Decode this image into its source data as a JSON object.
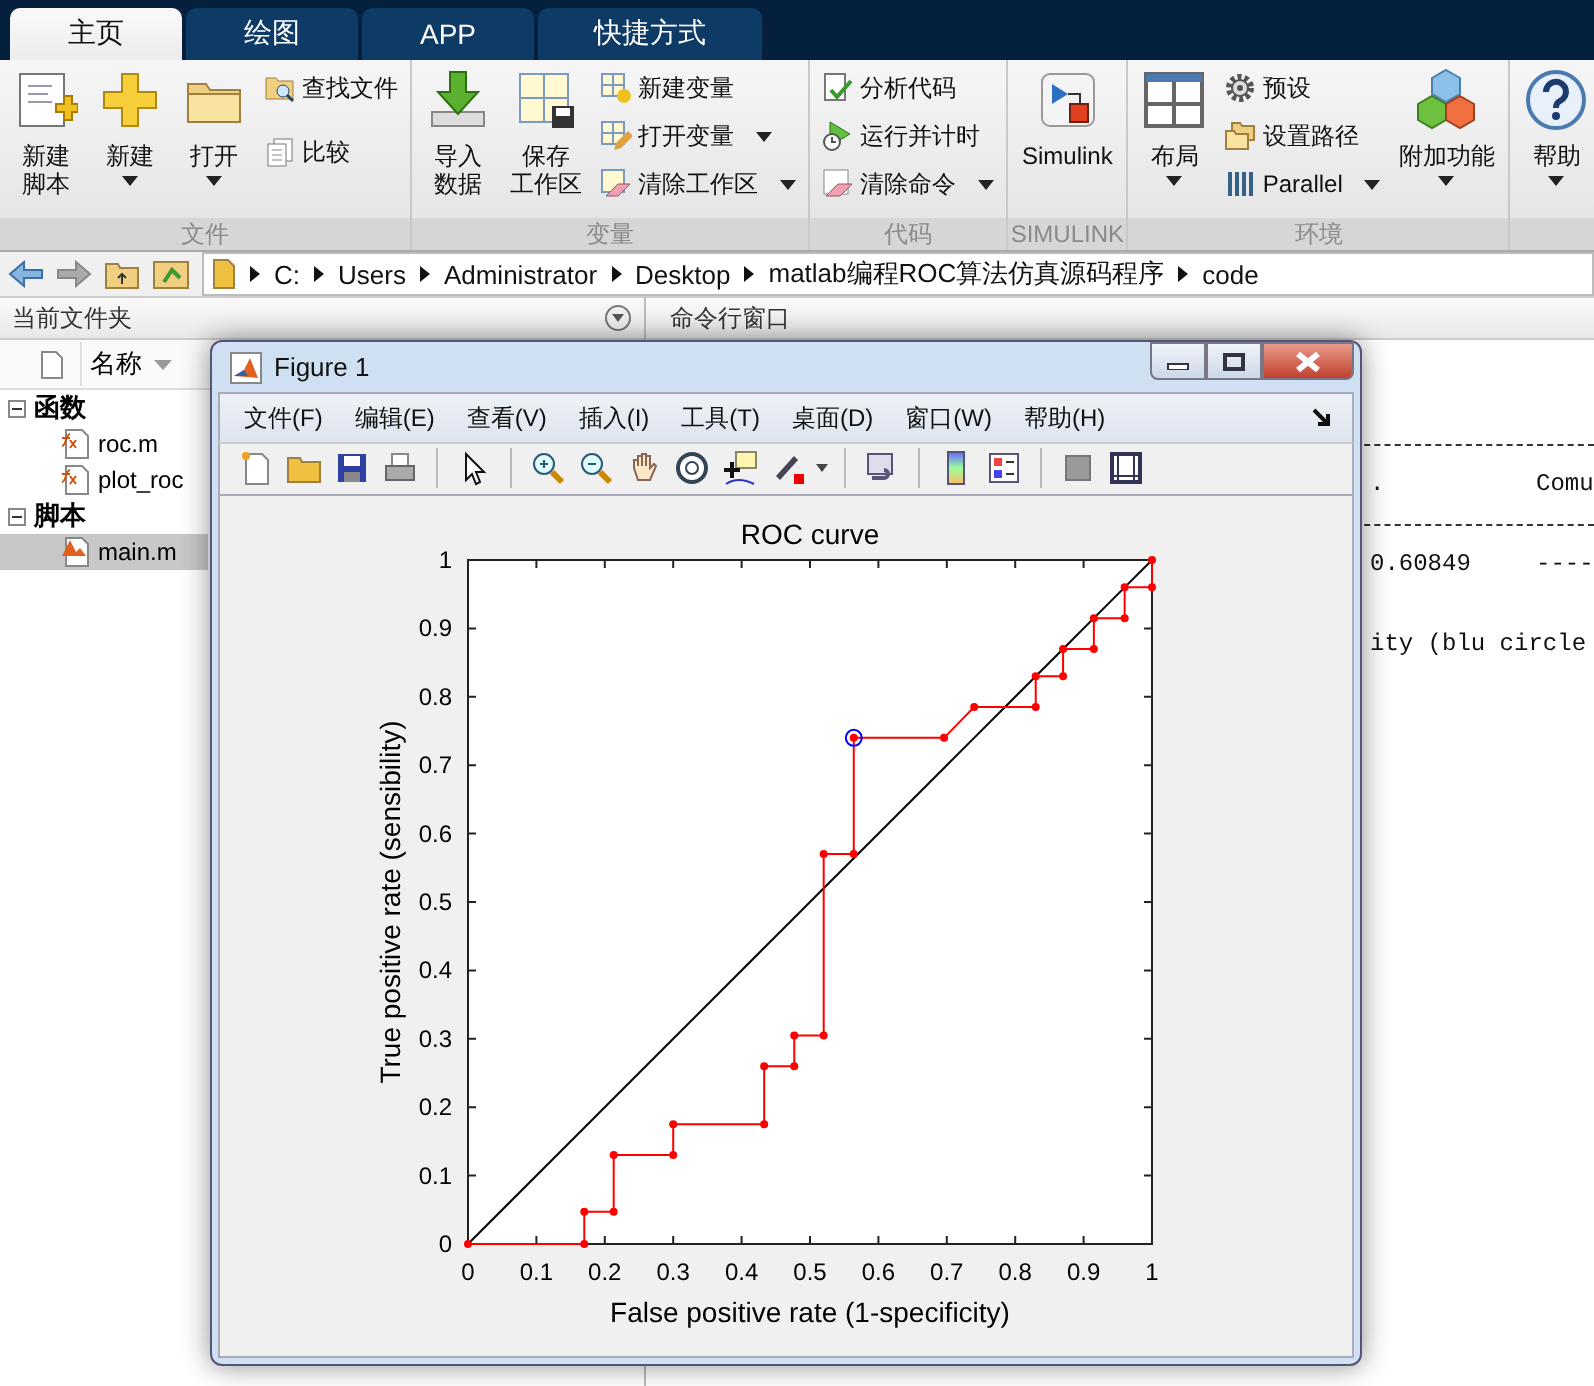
{
  "tabs": [
    {
      "label": "主页",
      "selected": true
    },
    {
      "label": "绘图",
      "selected": false
    },
    {
      "label": "APP",
      "selected": false
    },
    {
      "label": "快捷方式",
      "selected": false
    }
  ],
  "ribbon": {
    "groups": [
      {
        "label": "文件",
        "columns": [
          [
            {
              "kind": "large",
              "lines": [
                "新建",
                "脚本"
              ],
              "menu": false
            }
          ],
          [
            {
              "kind": "large",
              "lines": [
                "新建"
              ],
              "menu": true
            }
          ],
          [
            {
              "kind": "large",
              "lines": [
                "打开"
              ],
              "menu": true
            }
          ],
          [
            {
              "kind": "small",
              "lines": [
                "查找文件"
              ],
              "menu": false
            },
            {
              "kind": "small",
              "lines": [
                "比较"
              ],
              "menu": false
            }
          ]
        ]
      },
      {
        "label": "变量",
        "columns": [
          [
            {
              "kind": "large",
              "lines": [
                "导入",
                "数据"
              ],
              "menu": false
            }
          ],
          [
            {
              "kind": "large",
              "lines": [
                "保存",
                "工作区"
              ],
              "menu": false
            }
          ],
          [
            {
              "kind": "small",
              "lines": [
                "新建变量"
              ],
              "menu": false
            },
            {
              "kind": "small",
              "lines": [
                "打开变量"
              ],
              "menu": true
            },
            {
              "kind": "small",
              "lines": [
                "清除工作区"
              ],
              "menu": true
            }
          ]
        ]
      },
      {
        "label": "代码",
        "columns": [
          [
            {
              "kind": "small",
              "lines": [
                "分析代码"
              ],
              "menu": false
            },
            {
              "kind": "small",
              "lines": [
                "运行并计时"
              ],
              "menu": false
            },
            {
              "kind": "small",
              "lines": [
                "清除命令"
              ],
              "menu": true
            }
          ]
        ]
      },
      {
        "label": "SIMULINK",
        "columns": [
          [
            {
              "kind": "large",
              "lines": [
                "Simulink"
              ],
              "menu": false
            }
          ]
        ]
      },
      {
        "label": "环境",
        "columns": [
          [
            {
              "kind": "large",
              "lines": [
                "布局"
              ],
              "menu": true
            }
          ],
          [
            {
              "kind": "small",
              "lines": [
                "预设"
              ],
              "menu": false
            },
            {
              "kind": "small",
              "lines": [
                "设置路径"
              ],
              "menu": false
            },
            {
              "kind": "small",
              "lines": [
                "Parallel"
              ],
              "menu": true
            }
          ],
          [
            {
              "kind": "large",
              "lines": [
                "附加功能"
              ],
              "menu": true
            }
          ]
        ]
      },
      {
        "columns": [
          [
            {
              "kind": "large",
              "lines": [
                "帮助"
              ],
              "menu": true
            }
          ]
        ]
      }
    ]
  },
  "address_bar": {
    "path": [
      "C:",
      "Users",
      "Administrator",
      "Desktop",
      "matlab编程ROC算法仿真源码程序",
      "code"
    ]
  },
  "current_folder": {
    "title": "当前文件夹",
    "column": "名称",
    "tree": [
      {
        "label": "函数",
        "expanded": true,
        "children": [
          {
            "label": "roc.m",
            "kind": "function",
            "selected": false
          },
          {
            "label": "plot_roc",
            "kind": "function",
            "selected": false
          }
        ]
      },
      {
        "label": "脚本",
        "expanded": true,
        "children": [
          {
            "label": "main.m",
            "kind": "script",
            "selected": true
          }
        ]
      }
    ]
  },
  "command_window": {
    "title": "命令行窗口",
    "lines": [
      {
        "kind": "rule"
      },
      {
        "kind": "text",
        "cells": [
          ".",
          "Comu"
        ]
      },
      {
        "kind": "rule"
      },
      {
        "kind": "text",
        "cells": [
          "0.60849",
          "----"
        ]
      },
      {
        "kind": "blank"
      },
      {
        "kind": "text",
        "cells": [
          "ity (blu circle"
        ]
      }
    ]
  },
  "figure": {
    "title": "Figure 1",
    "menu": [
      "文件(F)",
      "编辑(E)",
      "查看(V)",
      "插入(I)",
      "工具(T)",
      "桌面(D)",
      "窗口(W)",
      "帮助(H)"
    ],
    "chart_data": {
      "type": "line",
      "title": "ROC curve",
      "xlabel": "False positive rate (1-specificity)",
      "ylabel": "True positive rate (sensibility)",
      "x": [
        0,
        0.17,
        0.17,
        0.213,
        0.213,
        0.3,
        0.3,
        0.433,
        0.433,
        0.477,
        0.477,
        0.52,
        0.52,
        0.564,
        0.564,
        0.696,
        0.74,
        0.83,
        0.83,
        0.87,
        0.87,
        0.915,
        0.915,
        0.96,
        0.96,
        1,
        1
      ],
      "series": [
        {
          "color": "#ff0000",
          "marker": "circle",
          "values": [
            0,
            0,
            0.047,
            0.047,
            0.13,
            0.13,
            0.175,
            0.175,
            0.26,
            0.26,
            0.305,
            0.305,
            0.57,
            0.57,
            0.74,
            0.74,
            0.785,
            0.785,
            0.83,
            0.83,
            0.87,
            0.87,
            0.915,
            0.915,
            0.96,
            0.96,
            1
          ]
        },
        {
          "color": "#000000",
          "values": [
            0,
            0.17,
            0.17,
            0.213,
            0.213,
            0.3,
            0.3,
            0.433,
            0.433,
            0.477,
            0.477,
            0.52,
            0.52,
            0.564,
            0.564,
            0.696,
            0.74,
            0.83,
            0.83,
            0.87,
            0.87,
            0.915,
            0.915,
            0.96,
            0.96,
            1,
            1
          ]
        },
        {
          "color": "#0000ff",
          "marker": "circle",
          "values": [
            null,
            null,
            null,
            null,
            null,
            null,
            null,
            null,
            null,
            null,
            null,
            null,
            null,
            null,
            0.74,
            null,
            null,
            null,
            null,
            null,
            null,
            null,
            null,
            null,
            null,
            null,
            null
          ]
        }
      ],
      "xlim": [
        0,
        1
      ],
      "ylim": [
        0,
        1
      ],
      "xticks": [
        0,
        0.1,
        0.2,
        0.3,
        0.4,
        0.5,
        0.6,
        0.7,
        0.8,
        0.9,
        1
      ],
      "yticks": [
        0,
        0.1,
        0.2,
        0.3,
        0.4,
        0.5,
        0.6,
        0.7,
        0.8,
        0.9,
        1
      ]
    }
  }
}
